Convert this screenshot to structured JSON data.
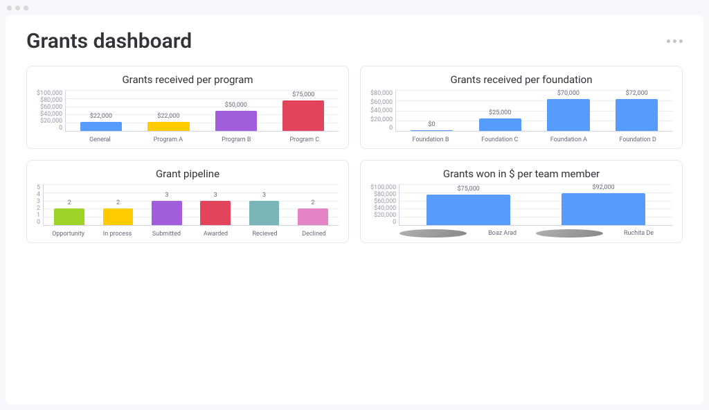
{
  "title": "Grants dashboard",
  "chart_data": [
    {
      "id": "per_program",
      "type": "bar",
      "title": "Grants received per program",
      "categories": [
        "General",
        "Program A",
        "Program B",
        "Program C"
      ],
      "values": [
        22000,
        22000,
        50000,
        75000
      ],
      "value_labels": [
        "$22,000",
        "$22,000",
        "$50,000",
        "$75,000"
      ],
      "y_ticks": [
        "$100,000",
        "$80,000",
        "$60,000",
        "$40,000",
        "$20,000",
        "0"
      ],
      "ylim": [
        0,
        100000
      ],
      "colors": [
        "#579bfc",
        "#ffcb00",
        "#a25ddc",
        "#e2445c"
      ]
    },
    {
      "id": "per_foundation",
      "type": "bar",
      "title": "Grants received per foundation",
      "categories": [
        "Foundation B",
        "Foundation C",
        "Foundation A",
        "Foundation D"
      ],
      "values": [
        0,
        25000,
        70000,
        72000
      ],
      "value_labels": [
        "$0",
        "$25,000",
        "$70,000",
        "$72,000"
      ],
      "y_ticks": [
        "$80,000",
        "$60,000",
        "$40,000",
        "$20,000",
        "0"
      ],
      "ylim": [
        0,
        80000
      ],
      "colors": [
        "#579bfc",
        "#579bfc",
        "#579bfc",
        "#579bfc"
      ]
    },
    {
      "id": "pipeline",
      "type": "bar",
      "title": "Grant pipeline",
      "categories": [
        "Opportunity",
        "In process",
        "Submitted",
        "Awarded",
        "Recieved",
        "Declined"
      ],
      "values": [
        2,
        2,
        3,
        3,
        3,
        2
      ],
      "value_labels": [
        "2",
        "2",
        "3",
        "3",
        "3",
        "2"
      ],
      "y_ticks": [
        "5",
        "4",
        "3",
        "2",
        "1",
        "0"
      ],
      "ylim": [
        0,
        5
      ],
      "colors": [
        "#9cd326",
        "#ffcb00",
        "#a25ddc",
        "#e2445c",
        "#66ccff",
        "#ff7ac4"
      ]
    },
    {
      "id": "per_member",
      "type": "bar",
      "title": "Grants won in $ per team member",
      "categories": [
        "Boaz Arad",
        "Ruchita De"
      ],
      "values": [
        75000,
        92000
      ],
      "value_labels": [
        "$75,000",
        "$92,000"
      ],
      "y_ticks": [
        "$100,000",
        "$80,000",
        "$60,000",
        "$40,000",
        "$20,000",
        "0"
      ],
      "ylim": [
        0,
        100000
      ],
      "colors": [
        "#579bfc",
        "#579bfc"
      ],
      "avatars": true
    }
  ]
}
